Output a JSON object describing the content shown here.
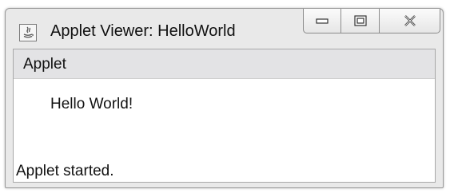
{
  "window": {
    "title": "Applet Viewer: HelloWorld",
    "app_icon": "java-icon",
    "controls": {
      "minimize_icon": "minimize-icon",
      "maximize_icon": "maximize-icon",
      "close_icon": "close-icon"
    }
  },
  "menubar": {
    "items": [
      {
        "label": "Applet"
      }
    ]
  },
  "applet": {
    "text": "Hello World!"
  },
  "status": {
    "text": "Applet started."
  },
  "colors": {
    "window_frame": "#e9e9e9",
    "menubar_bg": "#e3e3e5",
    "client_bg": "#ffffff"
  }
}
